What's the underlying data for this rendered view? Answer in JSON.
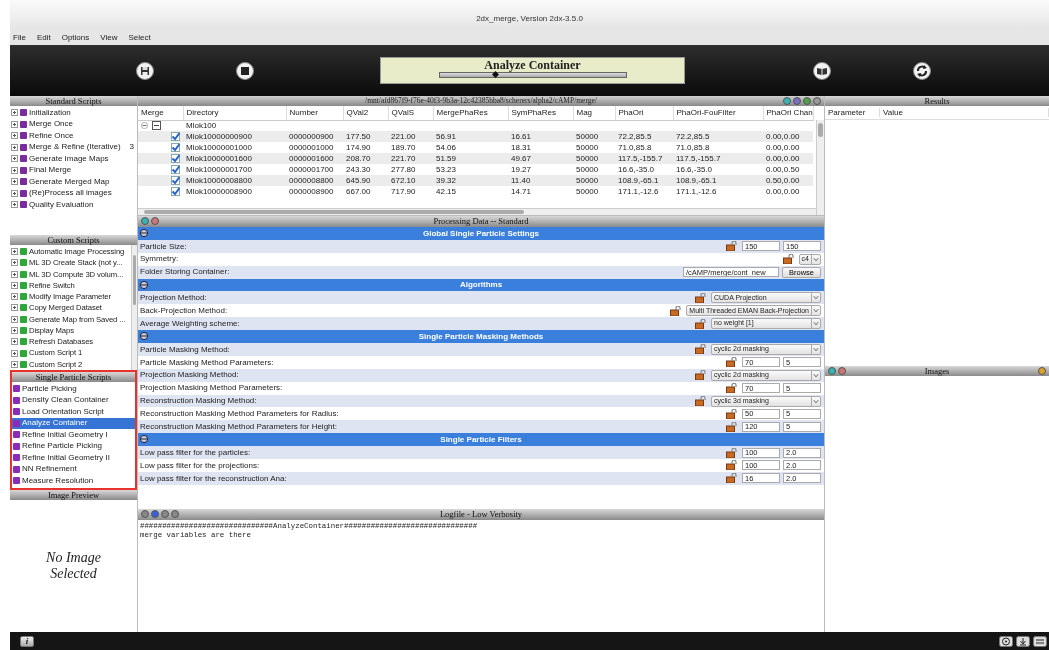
{
  "window": {
    "title": "2dx_merge, Version 2dx-3.5.0"
  },
  "menu": [
    "File",
    "Edit",
    "Options",
    "View",
    "Select"
  ],
  "toolbar": {
    "title": "Analyze Container",
    "level": 0.3
  },
  "standard_scripts": {
    "title": "Standard Scripts",
    "items": [
      {
        "label": "Initialization"
      },
      {
        "label": "Merge Once"
      },
      {
        "label": "Refine Once"
      },
      {
        "label": "Merge & Refine (Iterative)",
        "count": "3"
      },
      {
        "label": "Generate Image Maps"
      },
      {
        "label": "Final Merge"
      },
      {
        "label": "Generate Merged Map"
      },
      {
        "label": "(Re)Process all images"
      },
      {
        "label": "Quality Evaluation"
      }
    ]
  },
  "custom_scripts": {
    "title": "Custom Scripts",
    "items": [
      {
        "label": "Automatic Image Processing"
      },
      {
        "label": "ML 3D Create Stack (not y..."
      },
      {
        "label": "ML 3D Compute 3D volum..."
      },
      {
        "label": "Refine Switch"
      },
      {
        "label": "Modify Image Parameter"
      },
      {
        "label": "Copy Merged Dataset"
      },
      {
        "label": "Generate Map from Saved ..."
      },
      {
        "label": "Display Maps"
      },
      {
        "label": "Refresh Databases"
      },
      {
        "label": "Custom Script 1"
      },
      {
        "label": "Custom Script 2"
      }
    ]
  },
  "single_particle_scripts": {
    "title": "Single Particle Scripts",
    "items": [
      {
        "label": "Particle Picking",
        "selected": false
      },
      {
        "label": "Density Clean Container",
        "selected": false
      },
      {
        "label": "Load Orientation Script",
        "selected": false
      },
      {
        "label": "Analyze Container",
        "selected": true
      },
      {
        "label": "Refine Initial Geometry I",
        "selected": false
      },
      {
        "label": "Refine Particle Picking",
        "selected": false
      },
      {
        "label": "Refine Initial Geometry II",
        "selected": false
      },
      {
        "label": "NN Refinement",
        "selected": false
      },
      {
        "label": "Measure Resolution",
        "selected": false
      }
    ]
  },
  "image_preview": {
    "title": "Image Preview",
    "message": "No Image Selected"
  },
  "directory_table": {
    "path": "/mnt/afd867f9-f76e-40f3-9b3a-12c42385bba8/scherers/alpha2/cAMP/merge/",
    "merge_column": "Merge",
    "columns": [
      "Directory",
      "Number",
      "QVal2",
      "QValS",
      "MergePhaRes",
      "SymPhaRes",
      "Mag",
      "PhaOri",
      "PhaOri-FouFilter",
      "PhaOri Chan"
    ],
    "group": {
      "label": "Mlok100",
      "expanded": true
    },
    "rows": [
      {
        "checked": true,
        "cells": [
          "Mlok10000000900",
          "0000000900",
          "177.50",
          "221.00",
          "56.91",
          "16.61",
          "50000",
          "72.2,85.5",
          "72.2,85.5",
          "0.00,0.00"
        ]
      },
      {
        "checked": true,
        "cells": [
          "Mlok10000001000",
          "0000001000",
          "174.90",
          "189.70",
          "54.06",
          "18.31",
          "50000",
          "71.0,85.8",
          "71.0,85.8",
          "0.00,0.00"
        ]
      },
      {
        "checked": true,
        "cells": [
          "Mlok10000001600",
          "0000001600",
          "208.70",
          "221.70",
          "51.59",
          "49.67",
          "50000",
          "117.5,-155.7",
          "117.5,-155.7",
          "0.00,0.00"
        ]
      },
      {
        "checked": true,
        "cells": [
          "Mlok10000001700",
          "0000001700",
          "243.30",
          "277.80",
          "53.23",
          "19.27",
          "50000",
          "16.6,-35.0",
          "16.6,-35.0",
          "0.00,0.50"
        ]
      },
      {
        "checked": true,
        "cells": [
          "Mlok10000008800",
          "0000008800",
          "645.90",
          "672.10",
          "39.32",
          "11.40",
          "50000",
          "108.9,-65.1",
          "108.9,-65.1",
          "0.50,0.00"
        ]
      },
      {
        "checked": true,
        "cells": [
          "Mlok10000008900",
          "0000008900",
          "667.00",
          "717.90",
          "42.15",
          "14.71",
          "50000",
          "171.1,-12.6",
          "171.1,-12.6",
          "0.00,0.00"
        ]
      }
    ]
  },
  "processing": {
    "title": "Processing Data -- Standard",
    "rows": [
      {
        "kind": "section",
        "label": "Global Single Particle Settings"
      },
      {
        "kind": "pair",
        "label": "Particle Size:",
        "values": [
          "150",
          "150"
        ]
      },
      {
        "kind": "select",
        "label": "Symmetry:",
        "value": "c4"
      },
      {
        "kind": "folder",
        "label": "Folder Storing Container:",
        "value": "/cAMP/merge/cont_new",
        "button": "Browse"
      },
      {
        "kind": "section",
        "label": "Algorithms"
      },
      {
        "kind": "select",
        "label": "Projection Method:",
        "value": "CUDA Projection"
      },
      {
        "kind": "select",
        "label": "Back-Projection Method:",
        "value": "Multi Threaded EMAN Back-Projection"
      },
      {
        "kind": "select",
        "label": "Average Weighting scheme:",
        "value": "no weight [1]"
      },
      {
        "kind": "section",
        "label": "Single Particle Masking Methods"
      },
      {
        "kind": "select",
        "label": "Particle Masking Method:",
        "value": "cyclic 2d masking"
      },
      {
        "kind": "pair",
        "label": "Particle Masking Method Parameters:",
        "values": [
          "70",
          "5"
        ]
      },
      {
        "kind": "select",
        "label": "Projection Masking Method:",
        "value": "cyclic 2d masking"
      },
      {
        "kind": "pair",
        "label": "Projection Masking Method Parameters:",
        "values": [
          "70",
          "5"
        ]
      },
      {
        "kind": "select",
        "label": "Reconstruction Masking Method:",
        "value": "cyclic 3d masking"
      },
      {
        "kind": "pair",
        "label": "Reconstruction Masking Method Parameters for Radius:",
        "values": [
          "50",
          "5"
        ]
      },
      {
        "kind": "pair",
        "label": "Reconstruction Masking Method Parameters for Height:",
        "values": [
          "120",
          "5"
        ]
      },
      {
        "kind": "section",
        "label": "Single Particle Filters"
      },
      {
        "kind": "pair",
        "label": "Low pass filter for the particles:",
        "values": [
          "100",
          "2.0"
        ]
      },
      {
        "kind": "pair",
        "label": "Low pass filter for the projections:",
        "values": [
          "100",
          "2.0"
        ]
      },
      {
        "kind": "pair",
        "label": "Low pass filter for the reconstruction Ana:",
        "values": [
          "16",
          "2.0"
        ]
      }
    ]
  },
  "logfile": {
    "title": "Logfile - Low Verbosity",
    "verbosity": [
      {
        "selected": false
      },
      {
        "selected": true
      },
      {
        "selected": false
      },
      {
        "selected": false
      }
    ],
    "lines": [
      "##############################AnalyzeContainer##############################",
      "merge variables are there"
    ]
  },
  "results": {
    "title": "Results",
    "columns": [
      "Parameter",
      "Value"
    ]
  },
  "images": {
    "title": "Images"
  },
  "status_bar": {
    "info": "i"
  }
}
